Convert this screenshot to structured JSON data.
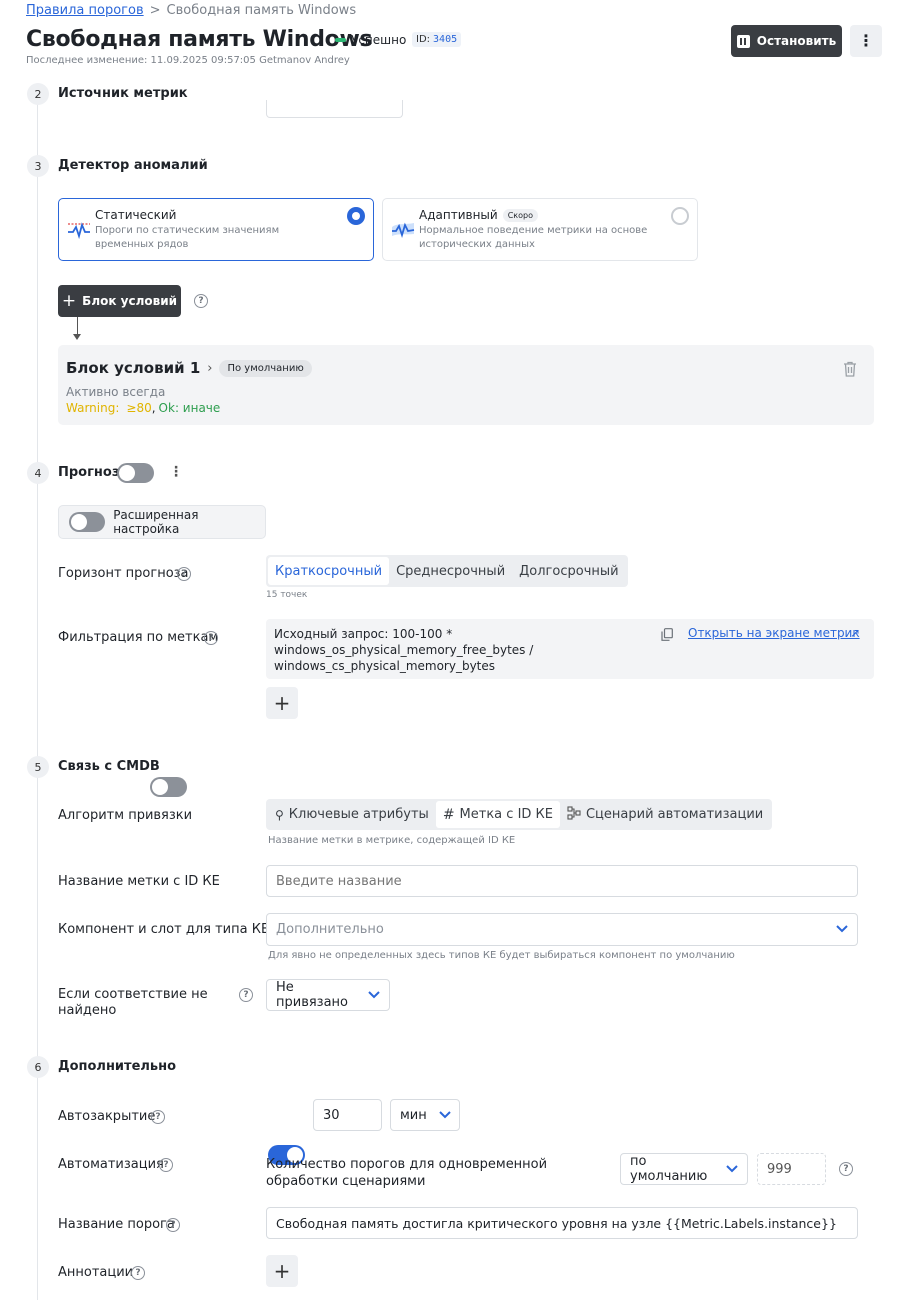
{
  "breadcrumb": {
    "parent": "Правила порогов",
    "sep": ">",
    "current": "Свободная память Windows"
  },
  "header": {
    "title": "Свободная память Windows",
    "status": "Успешно",
    "id_label": "ID:",
    "id_value": "3405",
    "last_modified": "Последнее изменение: 11.09.2025 09:57:05 Getmanov Andrey",
    "stop_label": "Остановить"
  },
  "sections": {
    "s2": {
      "num": "2",
      "title": "Источник метрик"
    },
    "s3": {
      "num": "3",
      "title": "Детектор аномалий"
    },
    "s4": {
      "num": "4",
      "title": "Прогноз"
    },
    "s5": {
      "num": "5",
      "title": "Связь с CMDB"
    },
    "s6": {
      "num": "6",
      "title": "Дополнительно"
    }
  },
  "detector": {
    "static": {
      "title": "Статический",
      "desc": "Пороги по статическим значениям временных рядов",
      "selected": true
    },
    "adaptive": {
      "title": "Адаптивный",
      "badge": "Скоро",
      "desc": "Нормальное поведение метрики на основе исторических данных",
      "selected": false
    }
  },
  "conditions": {
    "add_label": "Блок условий",
    "block": {
      "title": "Блок условий 1",
      "badge": "По умолчанию",
      "active": "Активно всегда",
      "warning": "Warning:",
      "warning_value": "≥80",
      "comma": ",",
      "ok": "Ok: иначе"
    }
  },
  "forecast": {
    "advanced_label": "Расширенная настройка",
    "horizon_label": "Горизонт прогноза",
    "horizon_options": [
      "Краткосрочный",
      "Среднесрочный",
      "Долгосрочный"
    ],
    "horizon_hint": "15 точек",
    "filter_label": "Фильтрация по меткам",
    "query_text": "Исходный запрос: 100-100 * windows_os_physical_memory_free_bytes / windows_cs_physical_memory_bytes",
    "open_link": "Открыть на экране метрик"
  },
  "cmdb": {
    "algo_label": "Алгоритм привязки",
    "algo_options": [
      "Ключевые атрибуты",
      "Метка с ID КЕ",
      "Сценарий автоматизации"
    ],
    "algo_hint": "Название метки в метрике, содержащей ID КЕ",
    "label_name_label": "Название метки с ID КЕ",
    "label_name_placeholder": "Введите название",
    "component_label": "Компонент и слот для типа КЕ",
    "component_placeholder": "Дополнительно",
    "component_hint": "Для явно не определенных здесь типов КЕ будет выбираться компонент по умолчанию",
    "notfound_label": "Если соответствие не найдено",
    "notfound_value": "Не привязано"
  },
  "extra": {
    "autoclose_label": "Автозакрытие",
    "autoclose_value": "30",
    "autoclose_unit": "мин",
    "automation_label": "Автоматизация",
    "automation_desc": "Количество порогов для одновременной обработки сценариями",
    "automation_select": "по умолчанию",
    "automation_placeholder": "999",
    "threshold_name_label": "Название порога",
    "threshold_name_value": "Свободная память достигла критического уровня на узле {{Metric.Labels.instance}}",
    "annotations_label": "Аннотации"
  },
  "colors": {
    "accent": "#2a66d9",
    "success": "#2bb673",
    "warning": "#e0b400",
    "ok": "#2e9e4f",
    "dark_button": "#3a3d42"
  }
}
